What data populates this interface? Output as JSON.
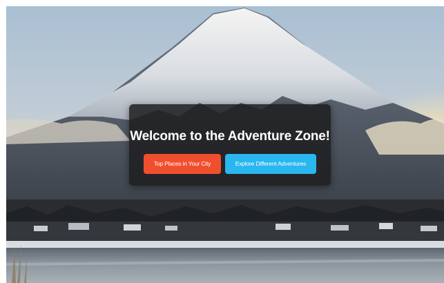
{
  "hero": {
    "title": "Welcome to the Adventure Zone!",
    "buttons": [
      {
        "label": "Top Places in Your City",
        "color": "#f04f2e"
      },
      {
        "label": "Explore Different Adventures",
        "color": "#2ab6ef"
      }
    ]
  },
  "colors": {
    "card_background": "#1e1e20",
    "title_text": "#ffffff"
  }
}
